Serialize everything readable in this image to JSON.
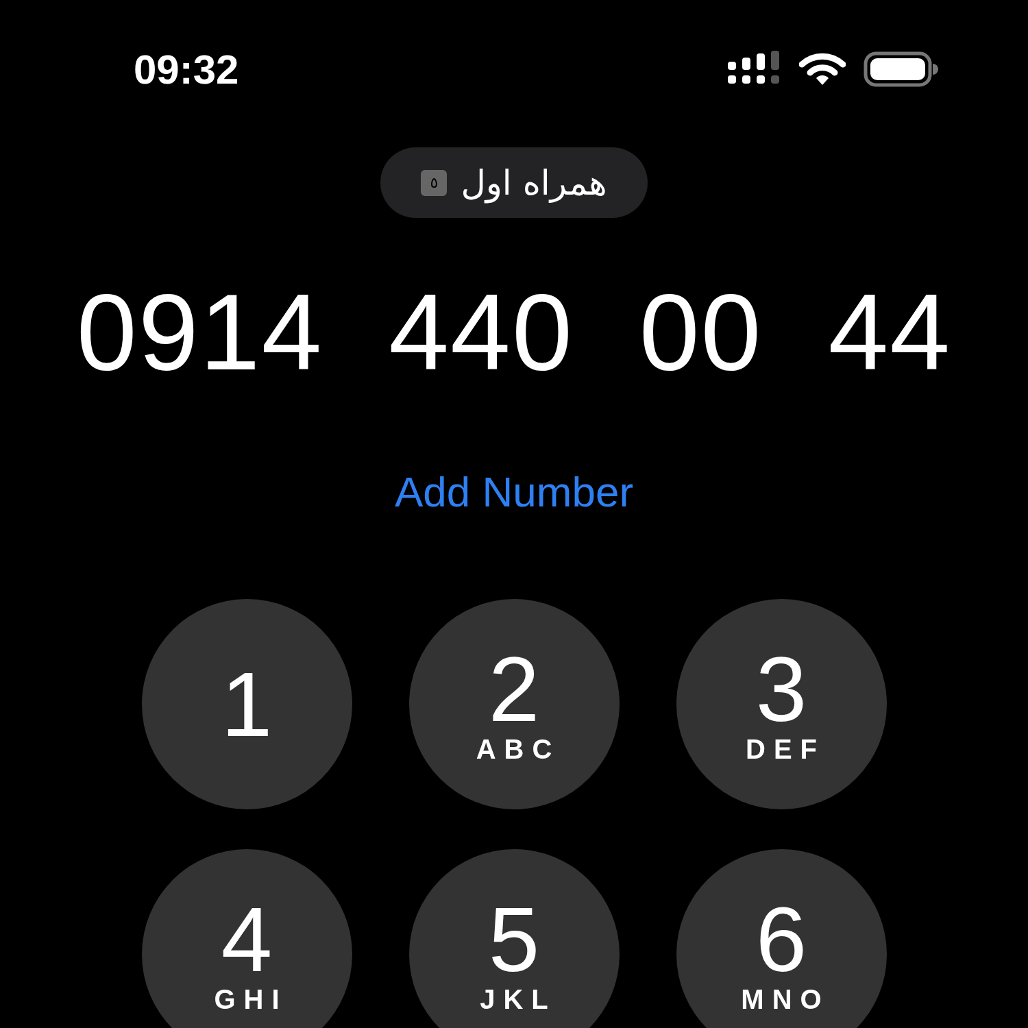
{
  "status_bar": {
    "time": "09:32"
  },
  "carrier": {
    "sim_label": "٥",
    "name": "همراه اول"
  },
  "dialed_number": "0914 440 00 44",
  "add_number": "Add Number",
  "keypad": [
    {
      "digit": "1"
    },
    {
      "digit": "2",
      "letters": "ABC"
    },
    {
      "digit": "3",
      "letters": "DEF"
    },
    {
      "digit": "4",
      "letters": "GHI"
    },
    {
      "digit": "5",
      "letters": "JKL"
    },
    {
      "digit": "6",
      "letters": "MNO"
    }
  ]
}
